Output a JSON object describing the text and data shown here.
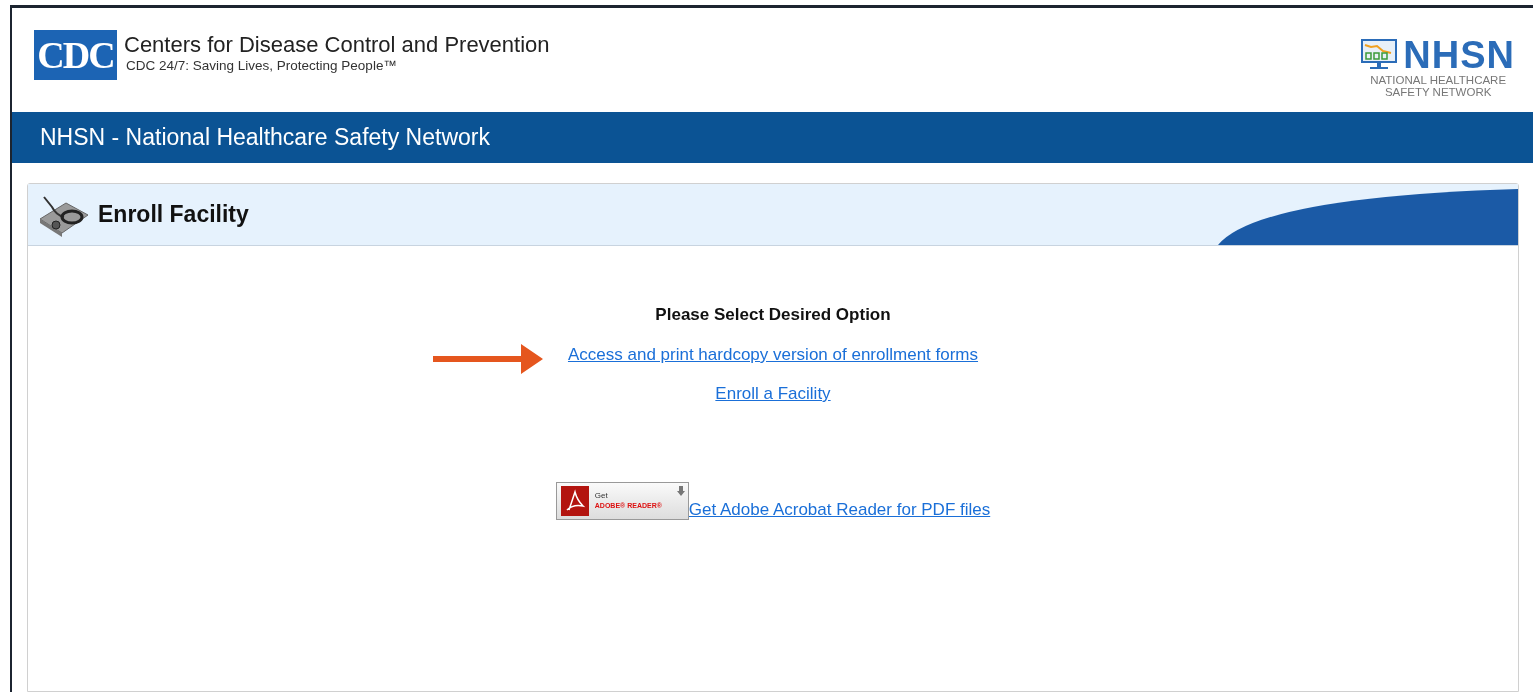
{
  "header": {
    "logo_text": "CDC",
    "title": "Centers for Disease Control and Prevention",
    "tagline": "CDC 24/7: Saving Lives, Protecting People™",
    "network_logo": {
      "acronym": "NHSN",
      "lines": [
        "NATIONAL HEALTHCARE",
        "SAFETY NETWORK"
      ]
    }
  },
  "banner": {
    "title": "NHSN - National Healthcare Safety Network"
  },
  "panel": {
    "title": "Enroll Facility",
    "heading": "Please Select Desired Option",
    "links": [
      {
        "label": "Access and print hardcopy version of enrollment forms",
        "arrow": true
      },
      {
        "label": "Enroll a Facility",
        "arrow": false
      }
    ],
    "reader_badge": {
      "line1": "Get",
      "line2": "ADOBE® READER®"
    },
    "reader_link": "Get Adobe Acrobat Reader for PDF files"
  }
}
